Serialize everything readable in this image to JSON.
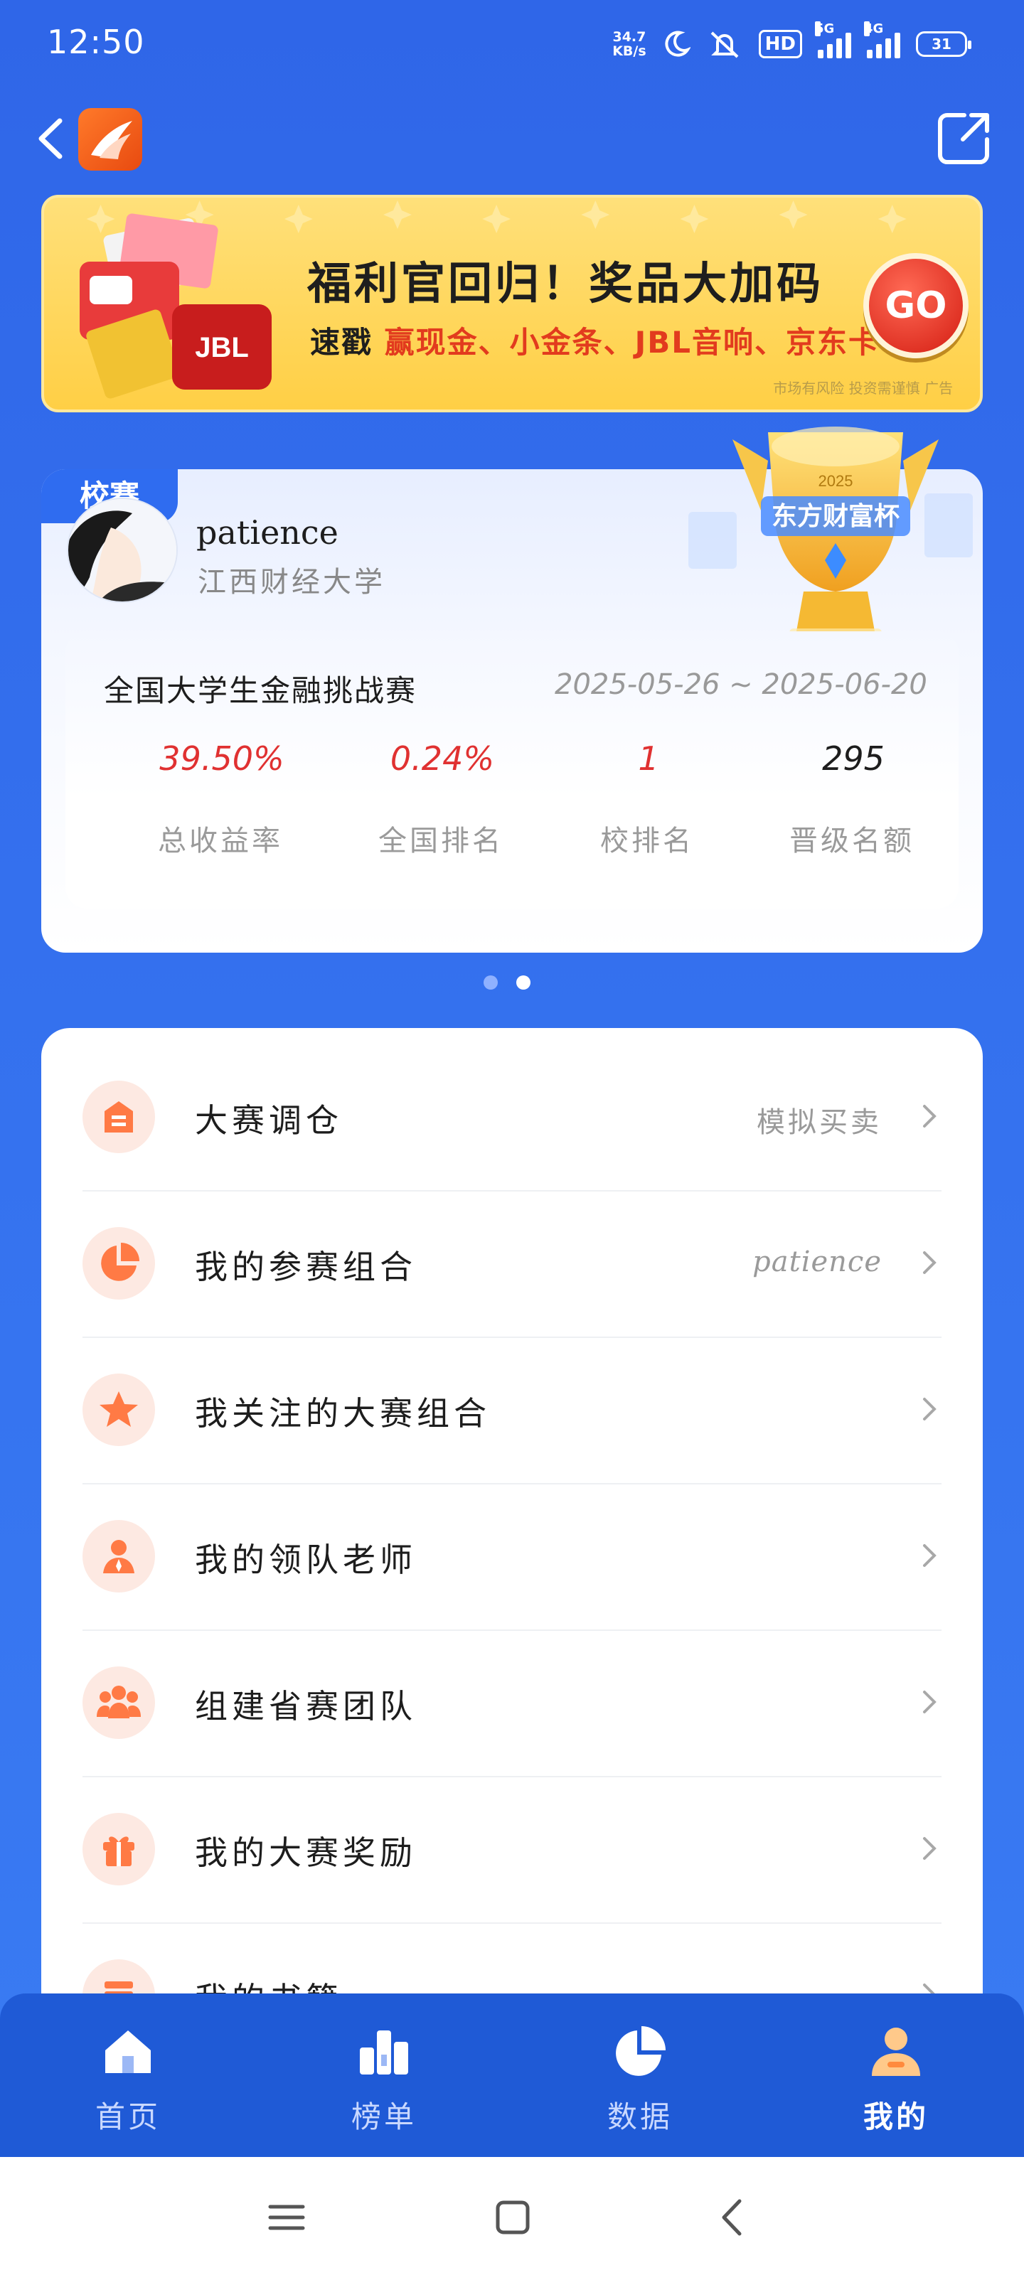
{
  "status_bar": {
    "time": "12:50",
    "net_speed_top": "34.7",
    "net_speed_unit": "KB/s",
    "hd_label": "HD",
    "signal_1_label": "5G",
    "signal_2_label": "4G",
    "battery": "31",
    "icons": [
      "moon-icon",
      "mute-icon",
      "signal-icon",
      "battery-icon"
    ]
  },
  "topbar": {
    "back_icon": "chevron-left-icon",
    "logo": "app-logo",
    "share_icon": "share-icon"
  },
  "banner": {
    "title": "福利官回归！奖品大加码",
    "sub_prefix": "速戳 ",
    "sub_highlight": "赢现金、小金条、JBL音响、京东卡",
    "go_label": "GO",
    "ad_note": "市场有风险 投资需谨慎 广告",
    "gift_brand": "JBL"
  },
  "contest_card": {
    "tag": "校赛",
    "user_name": "patience",
    "school": "江西财经大学",
    "trophy_year": "2025",
    "trophy_text": "东方财富杯",
    "contest_name": "全国大学生金融挑战赛",
    "dates": "2025-05-26 ~ 2025-06-20",
    "stats": [
      {
        "value": "39.50%",
        "label": "总收益率",
        "color": "#e03131"
      },
      {
        "value": "0.24%",
        "label": "全国排名",
        "color": "#e03131"
      },
      {
        "value": "1",
        "label": "校排名",
        "color": "#e03131"
      },
      {
        "value": "295",
        "label": "晋级名额",
        "color": "#1d1d1d"
      }
    ]
  },
  "pager": {
    "count": 2,
    "active": 2,
    "active_color": "#ffffff",
    "inactive_color": "#8fb1ff"
  },
  "menu": [
    {
      "label": "大赛调仓",
      "value": "模拟买卖",
      "icon": "building-icon"
    },
    {
      "label": "我的参赛组合",
      "value": "patience",
      "icon": "pie-chart-icon"
    },
    {
      "label": "我关注的大赛组合",
      "value": "",
      "icon": "star-icon"
    },
    {
      "label": "我的领队老师",
      "value": "",
      "icon": "teacher-icon"
    },
    {
      "label": "组建省赛团队",
      "value": "",
      "icon": "team-icon"
    },
    {
      "label": "我的大赛奖励",
      "value": "",
      "icon": "gift-icon"
    },
    {
      "label": "我的书籍",
      "value": "",
      "icon": "book-icon"
    }
  ],
  "tabbar": [
    {
      "label": "首页",
      "icon": "home-icon"
    },
    {
      "label": "榜单",
      "icon": "leaderboard-icon"
    },
    {
      "label": "数据",
      "icon": "data-pie-icon"
    },
    {
      "label": "我的",
      "icon": "profile-icon",
      "active": true
    }
  ],
  "system_nav": [
    "menu-icon",
    "home-square-icon",
    "back-icon"
  ],
  "colors": {
    "primary": "#2f6cf0",
    "accent_red": "#e03131",
    "icon_orange": "#ff7a45",
    "icon_bg": "#fde9e2"
  }
}
